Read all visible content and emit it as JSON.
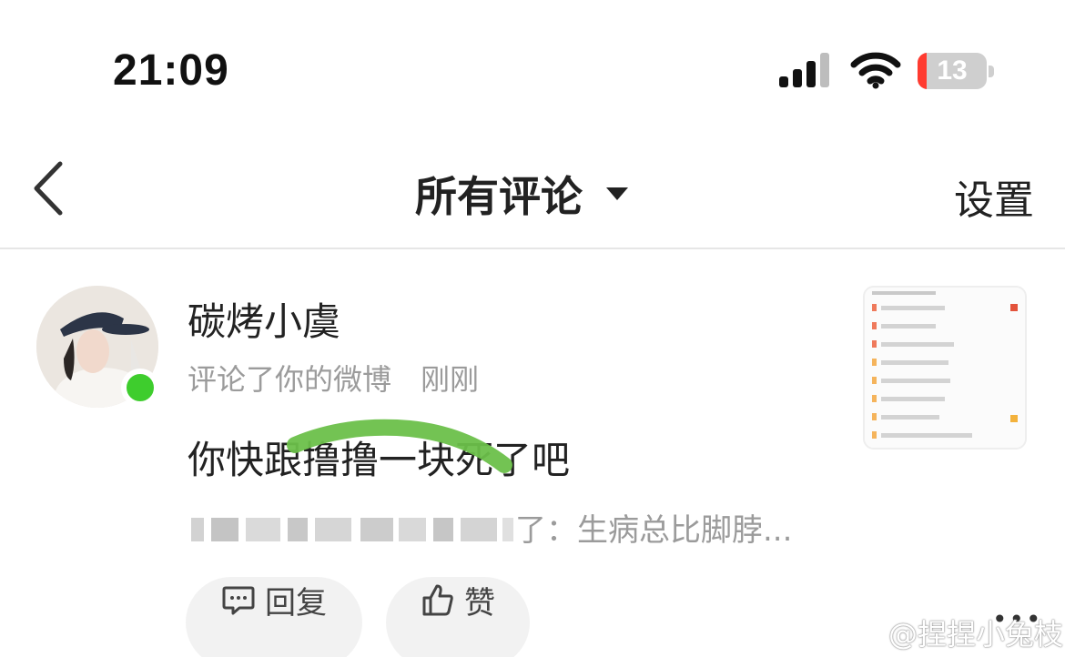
{
  "status_bar": {
    "time": "21:09",
    "battery_level": "13",
    "battery_fraction": 0.13,
    "icons": [
      "signal-icon",
      "wifi-icon",
      "battery-icon"
    ]
  },
  "nav": {
    "title": "所有评论",
    "settings_label": "设置",
    "icons": [
      "back-chevron-icon",
      "dropdown-caret-icon"
    ]
  },
  "comment": {
    "username": "碳烤小虞",
    "action": "评论了你的微博",
    "time": "刚刚",
    "text": "你快跟撸撸一块死了吧",
    "quoted_text": "了：生病总比脚脖...",
    "online_color": "#3ecd2d",
    "reply_label": "回复",
    "like_label": "赞"
  },
  "watermark": "@捏捏小兔枝",
  "colors": {
    "highlight_stroke": "#6cc04a",
    "text_primary": "#222222",
    "text_secondary": "#9b9b9b"
  }
}
